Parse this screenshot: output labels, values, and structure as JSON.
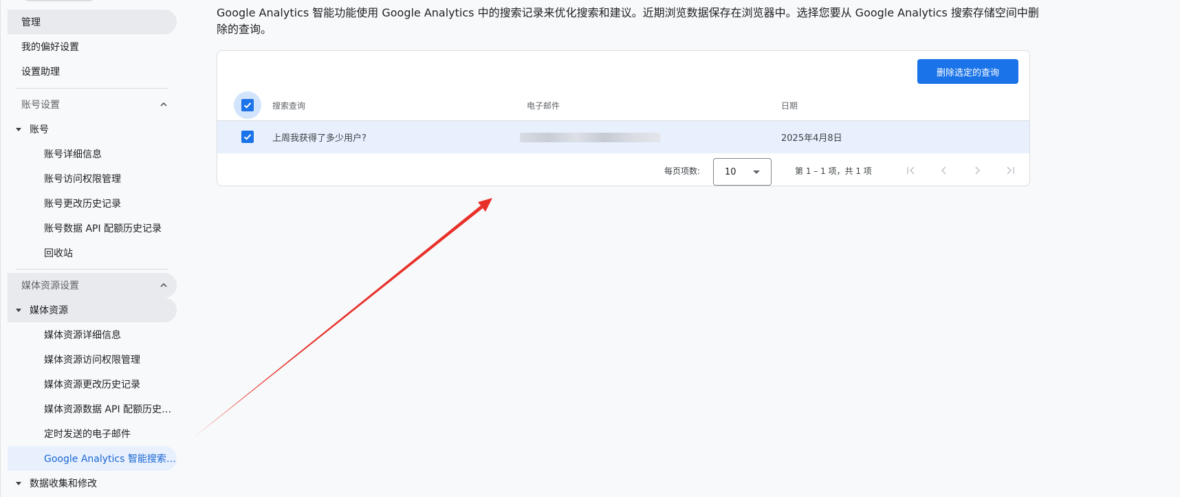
{
  "sidebar": {
    "admin": "管理",
    "preferences": "我的偏好设置",
    "setup_assistant": "设置助理",
    "account_settings": {
      "title": "账号设置",
      "group": "账号",
      "items": [
        "账号详细信息",
        "账号访问权限管理",
        "账号更改历史记录",
        "账号数据 API 配额历史记录",
        "回收站"
      ]
    },
    "property_settings": {
      "title": "媒体资源设置",
      "group": "媒体资源",
      "items": [
        "媒体资源详细信息",
        "媒体资源访问权限管理",
        "媒体资源更改历史记录",
        "媒体资源数据 API 配额历史记录",
        "定时发送的电子邮件",
        "Google Analytics 智能搜索记录"
      ]
    },
    "data_collection": "数据收集和修改"
  },
  "main": {
    "description": "Google Analytics 智能功能使用 Google Analytics 中的搜索记录来优化搜索和建议。近期浏览数据保存在浏览器中。选择您要从 Google Analytics 搜索存储空间中删除的查询。",
    "delete_button": "删除选定的查询",
    "table": {
      "columns": [
        "搜索查询",
        "电子邮件",
        "日期"
      ],
      "rows": [
        {
          "query": "上周我获得了多少用户?",
          "email": "",
          "date": "2025年4月8日",
          "selected": true
        }
      ]
    },
    "pagination": {
      "rows_per_page_label": "每页项数:",
      "rows_per_page_value": "10",
      "range_text": "第 1 – 1 项，共 1 项"
    }
  },
  "colors": {
    "accent": "#1a73e8",
    "selected_row": "#e8f0fe",
    "annotation_arrow": "#e8302a"
  }
}
